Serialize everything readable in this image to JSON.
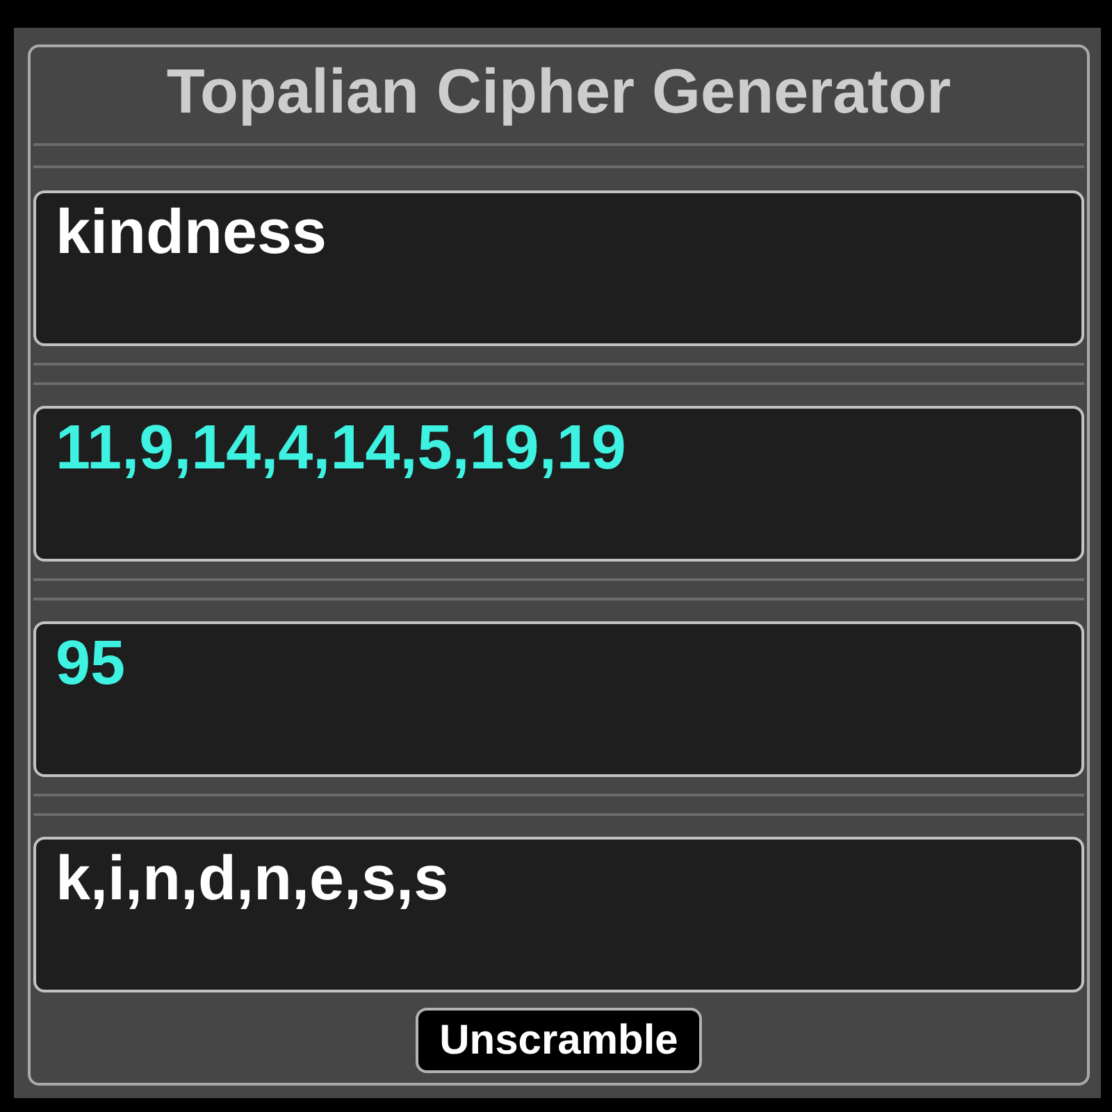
{
  "app": {
    "title": "Topalian Cipher Generator"
  },
  "fields": [
    {
      "kind": "text",
      "value": "kindness"
    },
    {
      "kind": "number",
      "value": "11,9,14,4,14,5,19,19"
    },
    {
      "kind": "number",
      "value": "95"
    },
    {
      "kind": "text",
      "value": "k,i,n,d,n,e,s,s"
    }
  ],
  "button": {
    "label": "Unscramble"
  }
}
